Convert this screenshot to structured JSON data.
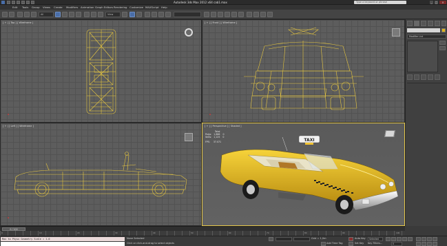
{
  "app": {
    "title": "Autodesk 3ds Max 2012 x64    cab1.max",
    "search_placeholder": "Type a keyword or phrase",
    "window_min": "_",
    "window_max": "□",
    "window_close": "×"
  },
  "menu": [
    "Edit",
    "Tools",
    "Group",
    "Views",
    "Create",
    "Modifiers",
    "Animation",
    "Graph Editors",
    "Rendering",
    "Customize",
    "MAXScript",
    "Help"
  ],
  "toolbar": {
    "selection_filter": "All",
    "view_dropdown": "View"
  },
  "viewports": {
    "top": "[ + ] [ Top ] [ Wireframe ]",
    "front": "[ + ] [ Front ] [ Wireframe ]",
    "left": "[ + ] [ Left ] [ Wireframe ]",
    "perspective": "[ + ] [ Perspective ] [ Shaded ]",
    "stats": {
      "header": "Total",
      "polys_label": "Polys:",
      "polys_value": "1,886",
      "polys_sel": "0",
      "verts_label": "Verts:",
      "verts_value": "1,125",
      "verts_sel": "0",
      "fps_label": "FPS:",
      "fps_value": "37.071"
    },
    "taxi_sign": "TAXI"
  },
  "command_panel": {
    "object_name": "",
    "modifier_list": "Modifier List",
    "wire_color": "#e0b21a"
  },
  "timeline": {
    "slider": "0 / 100",
    "ticks": [
      "0",
      "10",
      "20",
      "30",
      "40",
      "50",
      "60",
      "70",
      "80",
      "90",
      "100"
    ]
  },
  "status": {
    "maxscript_text": "Max to Physx Geometry Scale = 1.0",
    "selection_status": "None Selected",
    "prompt": "Click or click-and-drag to select objects",
    "grid": "Grid = 1,0m",
    "auto_key": "Auto Key",
    "selected_dropdown": "Selected",
    "set_key": "Set Key",
    "key_filters": "Key Filters...",
    "add_time_tag": "Add Time Tag",
    "frame_field": "0"
  }
}
